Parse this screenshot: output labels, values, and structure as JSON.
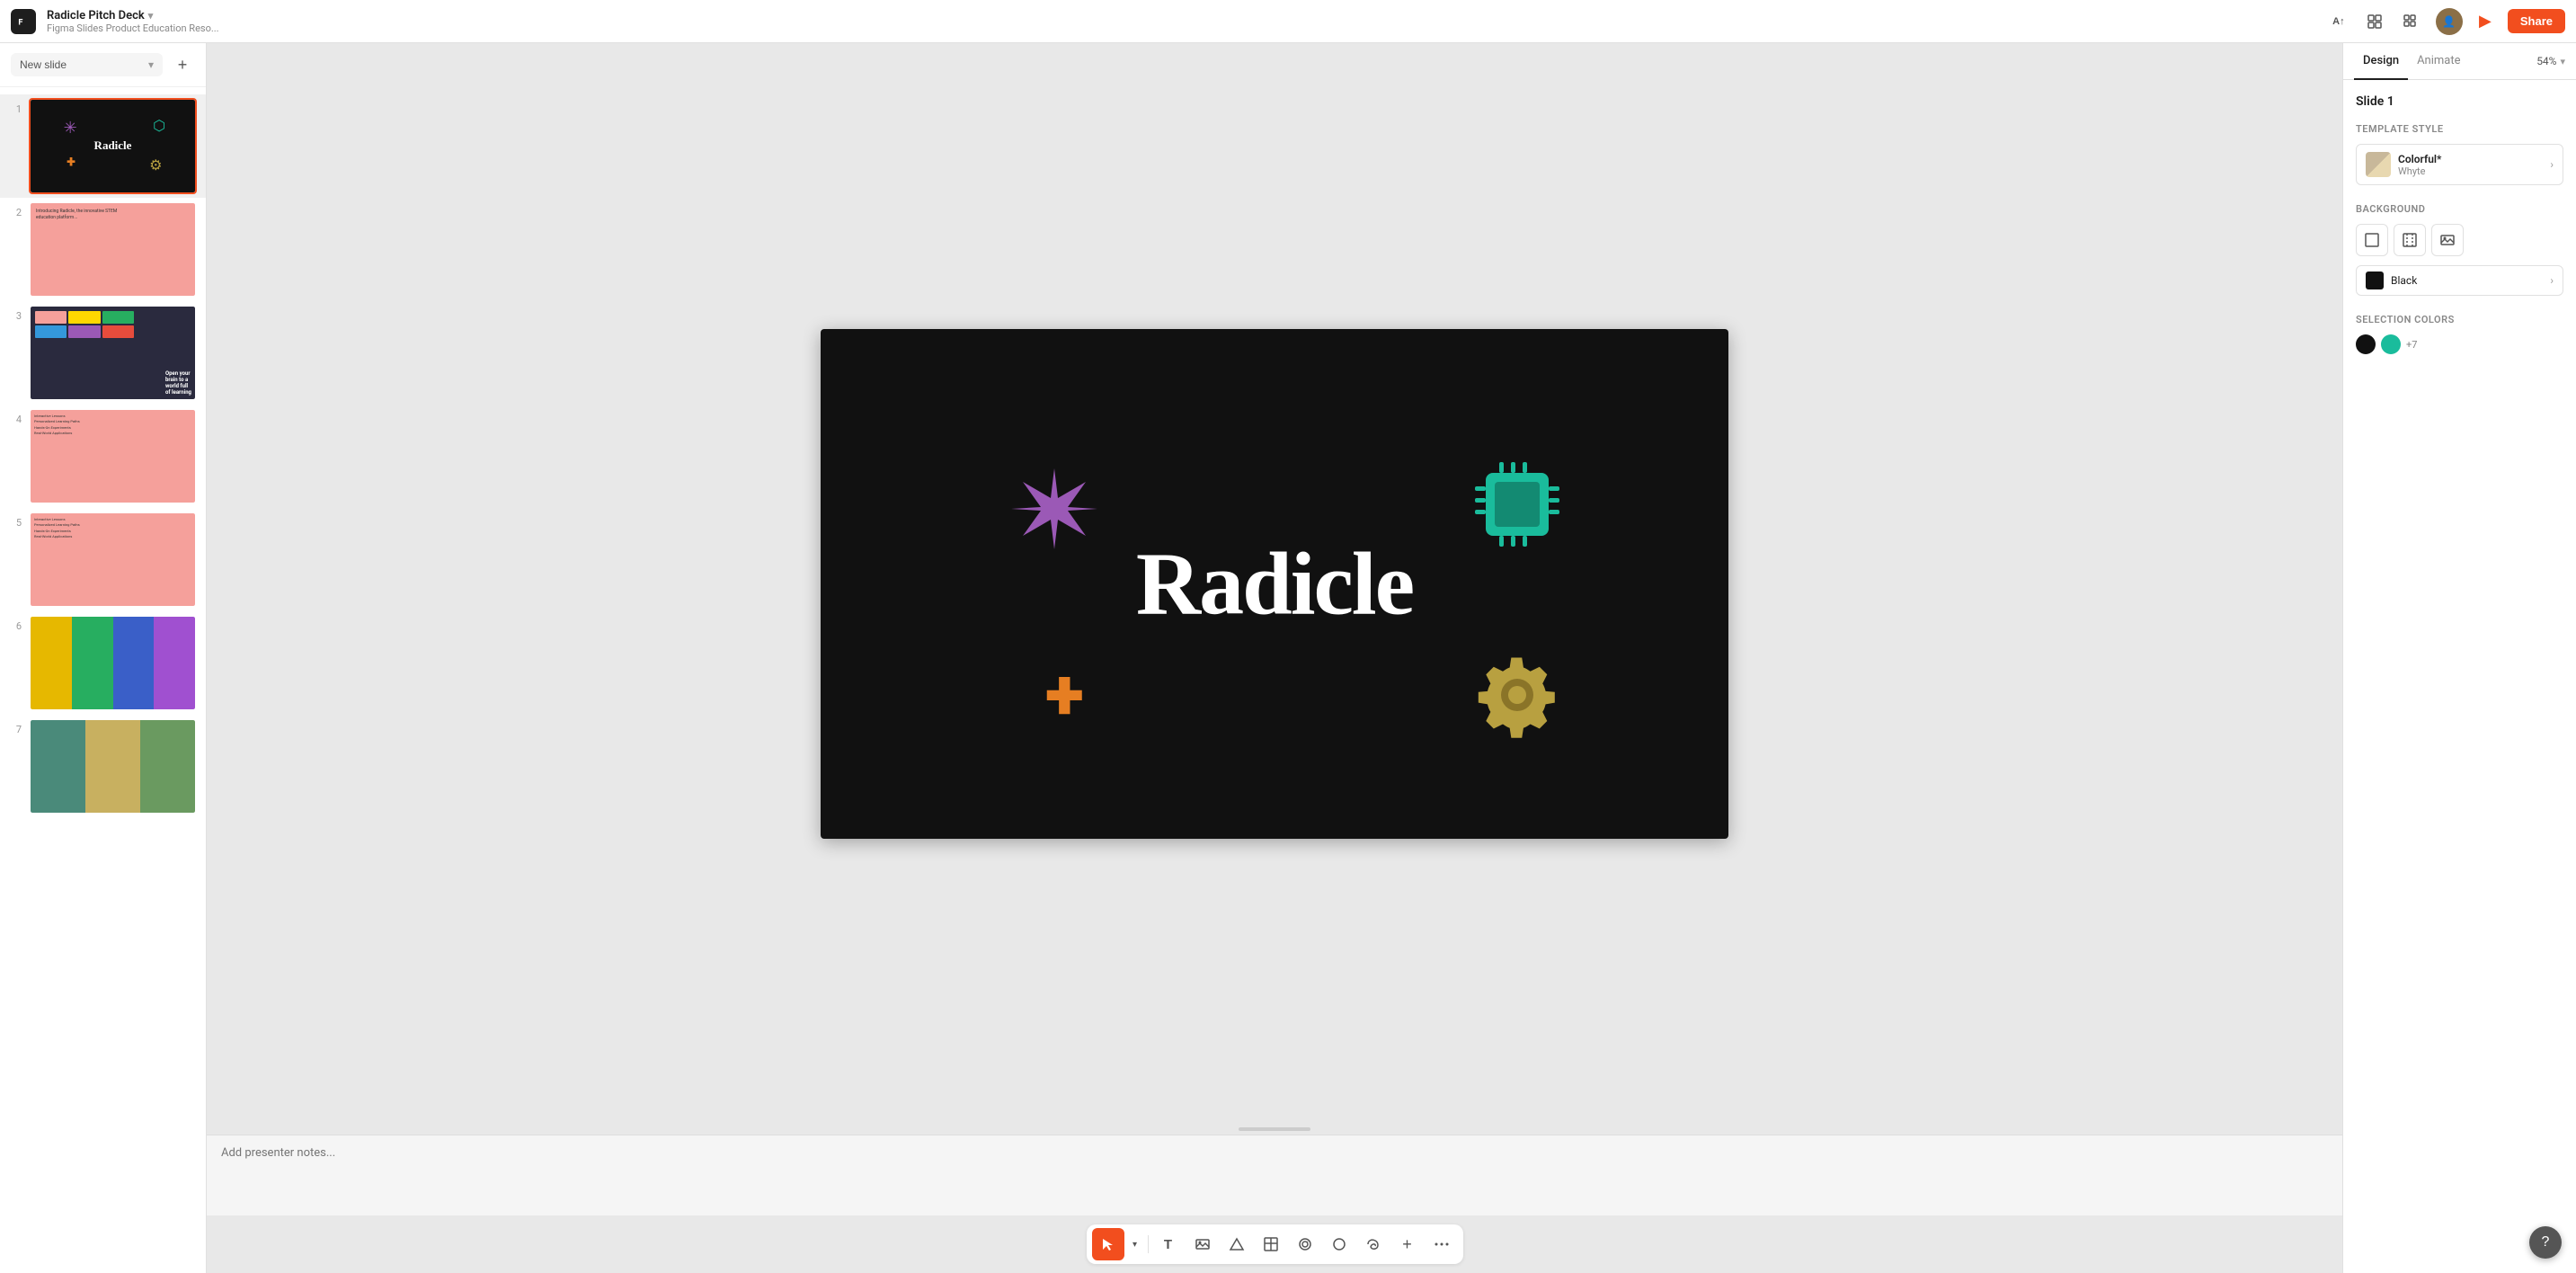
{
  "app": {
    "logo": "F",
    "filename": "Radicle Pitch Deck",
    "subtitle": "Figma Slides Product Education Reso...",
    "share_label": "Share",
    "play_icon": "▶"
  },
  "toolbar_top": {
    "ai_label": "A↑",
    "layout_icon": "⊞",
    "grid_icon": "⋮⋮"
  },
  "slides_panel": {
    "new_slide_label": "New slide",
    "new_slide_chevron": "▾",
    "add_icon": "+",
    "slides": [
      {
        "number": "1",
        "theme": "black",
        "active": true
      },
      {
        "number": "2",
        "theme": "pink",
        "active": false
      },
      {
        "number": "3",
        "theme": "dark",
        "active": false
      },
      {
        "number": "4",
        "theme": "pink",
        "active": false
      },
      {
        "number": "5",
        "theme": "pink",
        "active": false
      },
      {
        "number": "6",
        "theme": "multicolor",
        "active": false
      },
      {
        "number": "7",
        "theme": "teal",
        "active": false
      }
    ]
  },
  "canvas": {
    "title_text": "Radicle",
    "notes_placeholder": "Add presenter notes..."
  },
  "toolbar_bottom": {
    "pointer_icon": "↖",
    "text_icon": "T",
    "image_icon": "🖼",
    "shapes_icon": "⬡",
    "table_icon": "⊞",
    "pen_icon": "✏",
    "circle_icon": "○",
    "lasso_icon": "⌒",
    "plus_icon": "+",
    "dots_icon": "⋯"
  },
  "right_panel": {
    "tabs": [
      {
        "label": "Design",
        "active": true
      },
      {
        "label": "Animate",
        "active": false
      }
    ],
    "zoom_label": "54%",
    "zoom_chevron": "▾",
    "slide_title": "Slide 1",
    "template_section_title": "Template style",
    "template_name": "Colorful*",
    "template_sub": "Whyte",
    "template_chevron": "›",
    "background_section_title": "Background",
    "background_color": "Black",
    "background_chevron": "›",
    "selection_colors_title": "Selection colors",
    "selection_color_black": "#111111",
    "selection_color_green": "#1abc9c",
    "selection_colors_more": "+7"
  }
}
